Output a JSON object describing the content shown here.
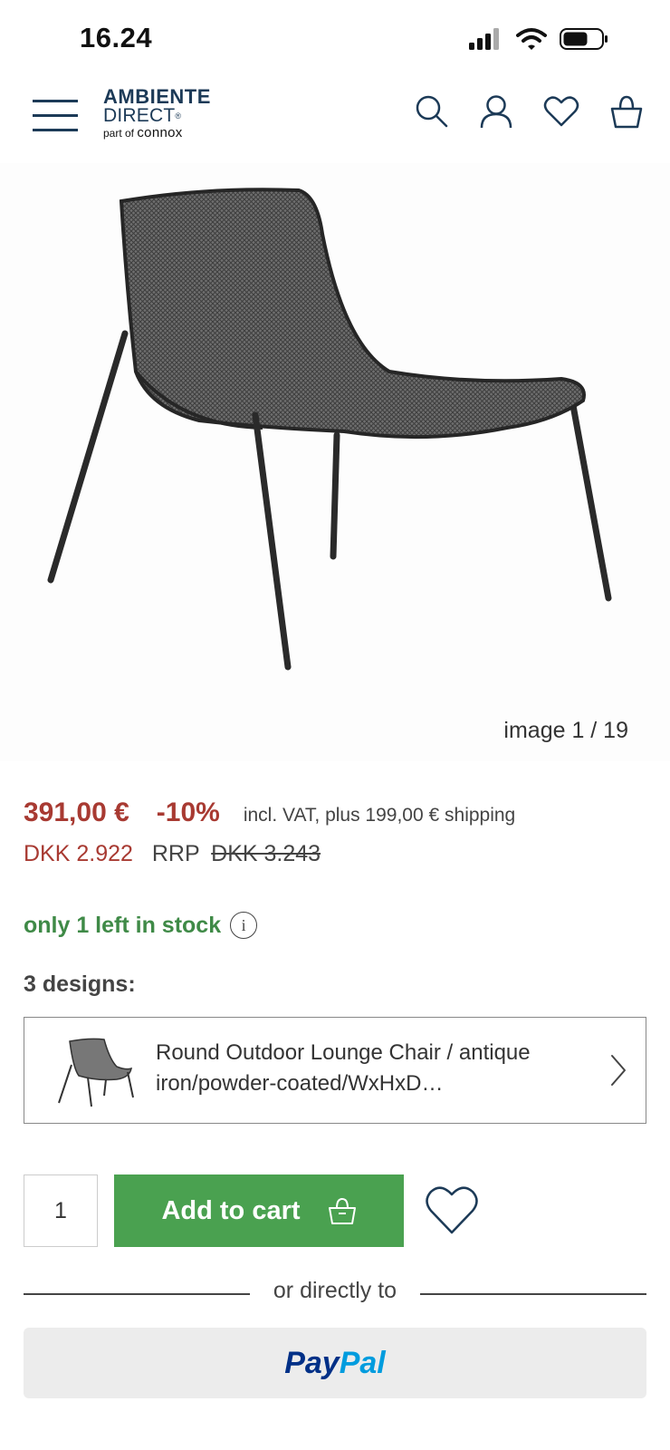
{
  "status_bar": {
    "time": "16.24"
  },
  "header": {
    "logo": {
      "line1": "AMBIENTE",
      "line2": "DIRECT",
      "registered": "®",
      "tagline_prefix": "part of",
      "tagline_brand": "connox"
    },
    "icons": [
      "search-icon",
      "account-icon",
      "wishlist-icon",
      "cart-icon"
    ],
    "brand_color": "#1c3a57"
  },
  "gallery": {
    "counter": "image 1 / 19"
  },
  "pricing": {
    "price": "391,00 €",
    "discount": "-10%",
    "vat_note": "incl. VAT, plus 199,00 € shipping",
    "price_dkk": "DKK 2.922",
    "rrp_label": "RRP",
    "rrp_old": "DKK 3.243",
    "price_color": "#a83a32"
  },
  "stock": {
    "text": "only 1 left in stock",
    "info_glyph": "i",
    "color": "#3f8a47"
  },
  "variants": {
    "label": "3 designs:",
    "selected": "Round Outdoor Lounge Chair / antique iron/powder-coated/WxHxD…"
  },
  "purchase": {
    "quantity": "1",
    "add_to_cart_label": "Add to cart",
    "button_color": "#4aa150"
  },
  "alt_payment": {
    "divider_text": "or directly to",
    "paypal_pay": "Pay",
    "paypal_pal": "Pal"
  }
}
